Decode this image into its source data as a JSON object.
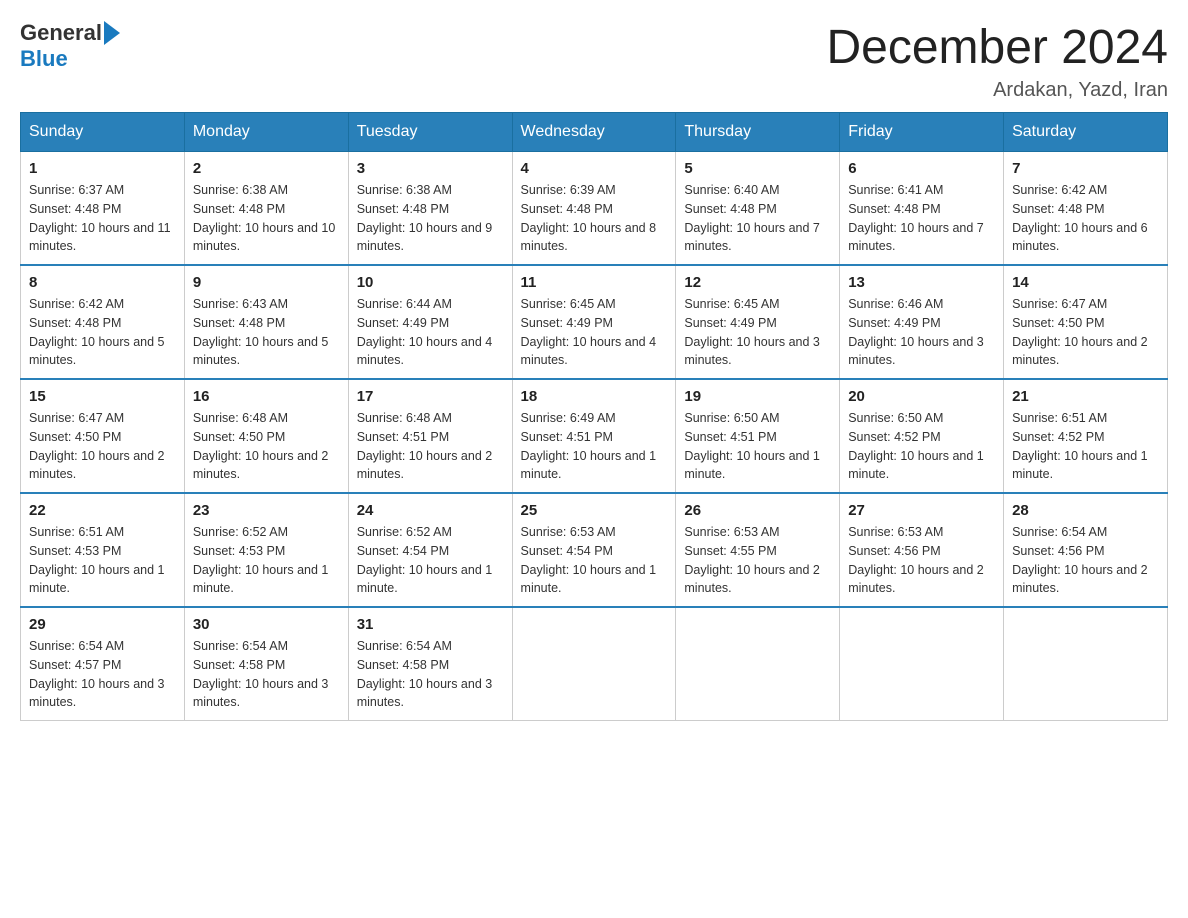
{
  "header": {
    "logo_general": "General",
    "logo_blue": "Blue",
    "title": "December 2024",
    "location": "Ardakan, Yazd, Iran"
  },
  "weekdays": [
    "Sunday",
    "Monday",
    "Tuesday",
    "Wednesday",
    "Thursday",
    "Friday",
    "Saturday"
  ],
  "weeks": [
    [
      {
        "day": "1",
        "sunrise": "6:37 AM",
        "sunset": "4:48 PM",
        "daylight": "10 hours and 11 minutes."
      },
      {
        "day": "2",
        "sunrise": "6:38 AM",
        "sunset": "4:48 PM",
        "daylight": "10 hours and 10 minutes."
      },
      {
        "day": "3",
        "sunrise": "6:38 AM",
        "sunset": "4:48 PM",
        "daylight": "10 hours and 9 minutes."
      },
      {
        "day": "4",
        "sunrise": "6:39 AM",
        "sunset": "4:48 PM",
        "daylight": "10 hours and 8 minutes."
      },
      {
        "day": "5",
        "sunrise": "6:40 AM",
        "sunset": "4:48 PM",
        "daylight": "10 hours and 7 minutes."
      },
      {
        "day": "6",
        "sunrise": "6:41 AM",
        "sunset": "4:48 PM",
        "daylight": "10 hours and 7 minutes."
      },
      {
        "day": "7",
        "sunrise": "6:42 AM",
        "sunset": "4:48 PM",
        "daylight": "10 hours and 6 minutes."
      }
    ],
    [
      {
        "day": "8",
        "sunrise": "6:42 AM",
        "sunset": "4:48 PM",
        "daylight": "10 hours and 5 minutes."
      },
      {
        "day": "9",
        "sunrise": "6:43 AM",
        "sunset": "4:48 PM",
        "daylight": "10 hours and 5 minutes."
      },
      {
        "day": "10",
        "sunrise": "6:44 AM",
        "sunset": "4:49 PM",
        "daylight": "10 hours and 4 minutes."
      },
      {
        "day": "11",
        "sunrise": "6:45 AM",
        "sunset": "4:49 PM",
        "daylight": "10 hours and 4 minutes."
      },
      {
        "day": "12",
        "sunrise": "6:45 AM",
        "sunset": "4:49 PM",
        "daylight": "10 hours and 3 minutes."
      },
      {
        "day": "13",
        "sunrise": "6:46 AM",
        "sunset": "4:49 PM",
        "daylight": "10 hours and 3 minutes."
      },
      {
        "day": "14",
        "sunrise": "6:47 AM",
        "sunset": "4:50 PM",
        "daylight": "10 hours and 2 minutes."
      }
    ],
    [
      {
        "day": "15",
        "sunrise": "6:47 AM",
        "sunset": "4:50 PM",
        "daylight": "10 hours and 2 minutes."
      },
      {
        "day": "16",
        "sunrise": "6:48 AM",
        "sunset": "4:50 PM",
        "daylight": "10 hours and 2 minutes."
      },
      {
        "day": "17",
        "sunrise": "6:48 AM",
        "sunset": "4:51 PM",
        "daylight": "10 hours and 2 minutes."
      },
      {
        "day": "18",
        "sunrise": "6:49 AM",
        "sunset": "4:51 PM",
        "daylight": "10 hours and 1 minute."
      },
      {
        "day": "19",
        "sunrise": "6:50 AM",
        "sunset": "4:51 PM",
        "daylight": "10 hours and 1 minute."
      },
      {
        "day": "20",
        "sunrise": "6:50 AM",
        "sunset": "4:52 PM",
        "daylight": "10 hours and 1 minute."
      },
      {
        "day": "21",
        "sunrise": "6:51 AM",
        "sunset": "4:52 PM",
        "daylight": "10 hours and 1 minute."
      }
    ],
    [
      {
        "day": "22",
        "sunrise": "6:51 AM",
        "sunset": "4:53 PM",
        "daylight": "10 hours and 1 minute."
      },
      {
        "day": "23",
        "sunrise": "6:52 AM",
        "sunset": "4:53 PM",
        "daylight": "10 hours and 1 minute."
      },
      {
        "day": "24",
        "sunrise": "6:52 AM",
        "sunset": "4:54 PM",
        "daylight": "10 hours and 1 minute."
      },
      {
        "day": "25",
        "sunrise": "6:53 AM",
        "sunset": "4:54 PM",
        "daylight": "10 hours and 1 minute."
      },
      {
        "day": "26",
        "sunrise": "6:53 AM",
        "sunset": "4:55 PM",
        "daylight": "10 hours and 2 minutes."
      },
      {
        "day": "27",
        "sunrise": "6:53 AM",
        "sunset": "4:56 PM",
        "daylight": "10 hours and 2 minutes."
      },
      {
        "day": "28",
        "sunrise": "6:54 AM",
        "sunset": "4:56 PM",
        "daylight": "10 hours and 2 minutes."
      }
    ],
    [
      {
        "day": "29",
        "sunrise": "6:54 AM",
        "sunset": "4:57 PM",
        "daylight": "10 hours and 3 minutes."
      },
      {
        "day": "30",
        "sunrise": "6:54 AM",
        "sunset": "4:58 PM",
        "daylight": "10 hours and 3 minutes."
      },
      {
        "day": "31",
        "sunrise": "6:54 AM",
        "sunset": "4:58 PM",
        "daylight": "10 hours and 3 minutes."
      },
      null,
      null,
      null,
      null
    ]
  ],
  "labels": {
    "sunrise": "Sunrise:",
    "sunset": "Sunset:",
    "daylight": "Daylight:"
  }
}
